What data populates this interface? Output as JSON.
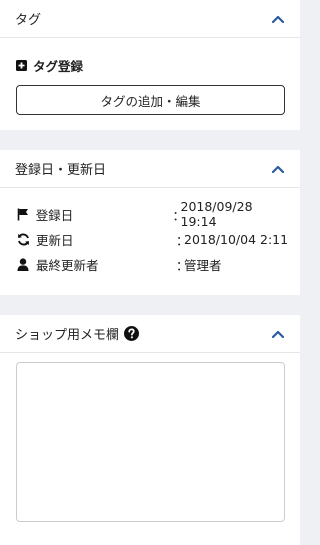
{
  "colors": {
    "accent": "#2c5aa0",
    "panel_bg": "#ffffff",
    "page_bg": "#eef0f4",
    "border": "#e3e5e9"
  },
  "tag_panel": {
    "title": "タグ",
    "collapse_icon": "chevron-up-icon",
    "register_icon": "plus-square-icon",
    "register_label": "タグ登録",
    "add_edit_button": "タグの追加・編集"
  },
  "dates_panel": {
    "title": "登録日・更新日",
    "collapse_icon": "chevron-up-icon",
    "rows": [
      {
        "icon": "flag-icon",
        "label": "登録日",
        "colon": "：",
        "value": "2018/09/28 19:14"
      },
      {
        "icon": "sync-icon",
        "label": "更新日",
        "colon": "：",
        "value": "2018/10/04 2:11"
      },
      {
        "icon": "user-icon",
        "label": "最終更新者",
        "colon": "：",
        "value": "管理者"
      }
    ]
  },
  "memo_panel": {
    "title": "ショップ用メモ欄",
    "help_icon": "question-circle-icon",
    "collapse_icon": "chevron-up-icon",
    "memo_value": ""
  }
}
